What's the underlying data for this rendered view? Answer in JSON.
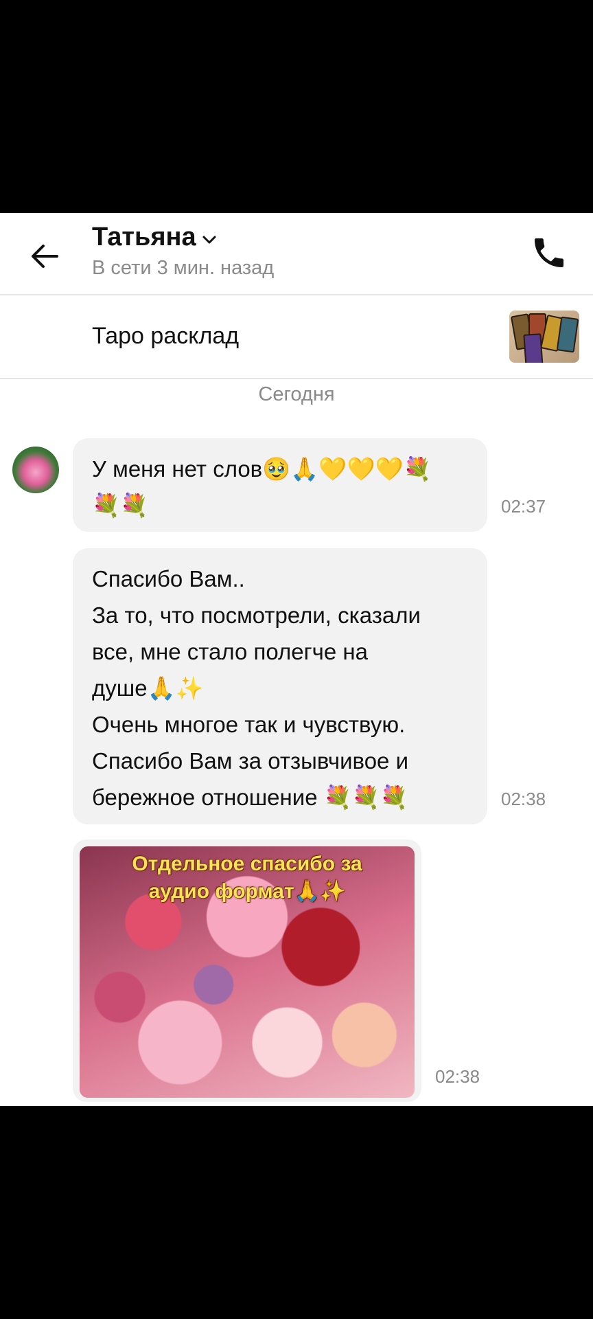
{
  "header": {
    "contact_name": "Татьяна",
    "status": "В сети 3 мин. назад"
  },
  "ad": {
    "title": "Таро расклад"
  },
  "date_separator": "Сегодня",
  "messages": [
    {
      "lines": [
        "У меня нет слов🥹🙏💛💛💛💐",
        "💐💐"
      ],
      "time": "02:37"
    },
    {
      "lines": [
        "Спасибо Вам..",
        "За то, что посмотрели, сказали",
        "все, мне стало полегче на",
        "душе🙏✨",
        "Очень многое так и чувствую.",
        "Спасибо Вам за  отзывчивое и",
        "бережное отношение 💐💐💐"
      ],
      "time": "02:38"
    }
  ],
  "image_message": {
    "caption_lines": [
      "Отдельное спасибо за",
      "аудио формат🙏✨"
    ],
    "time": "02:38"
  },
  "icons": {
    "back": "arrow-left-icon",
    "chevron": "chevron-down-icon",
    "call": "phone-icon"
  }
}
